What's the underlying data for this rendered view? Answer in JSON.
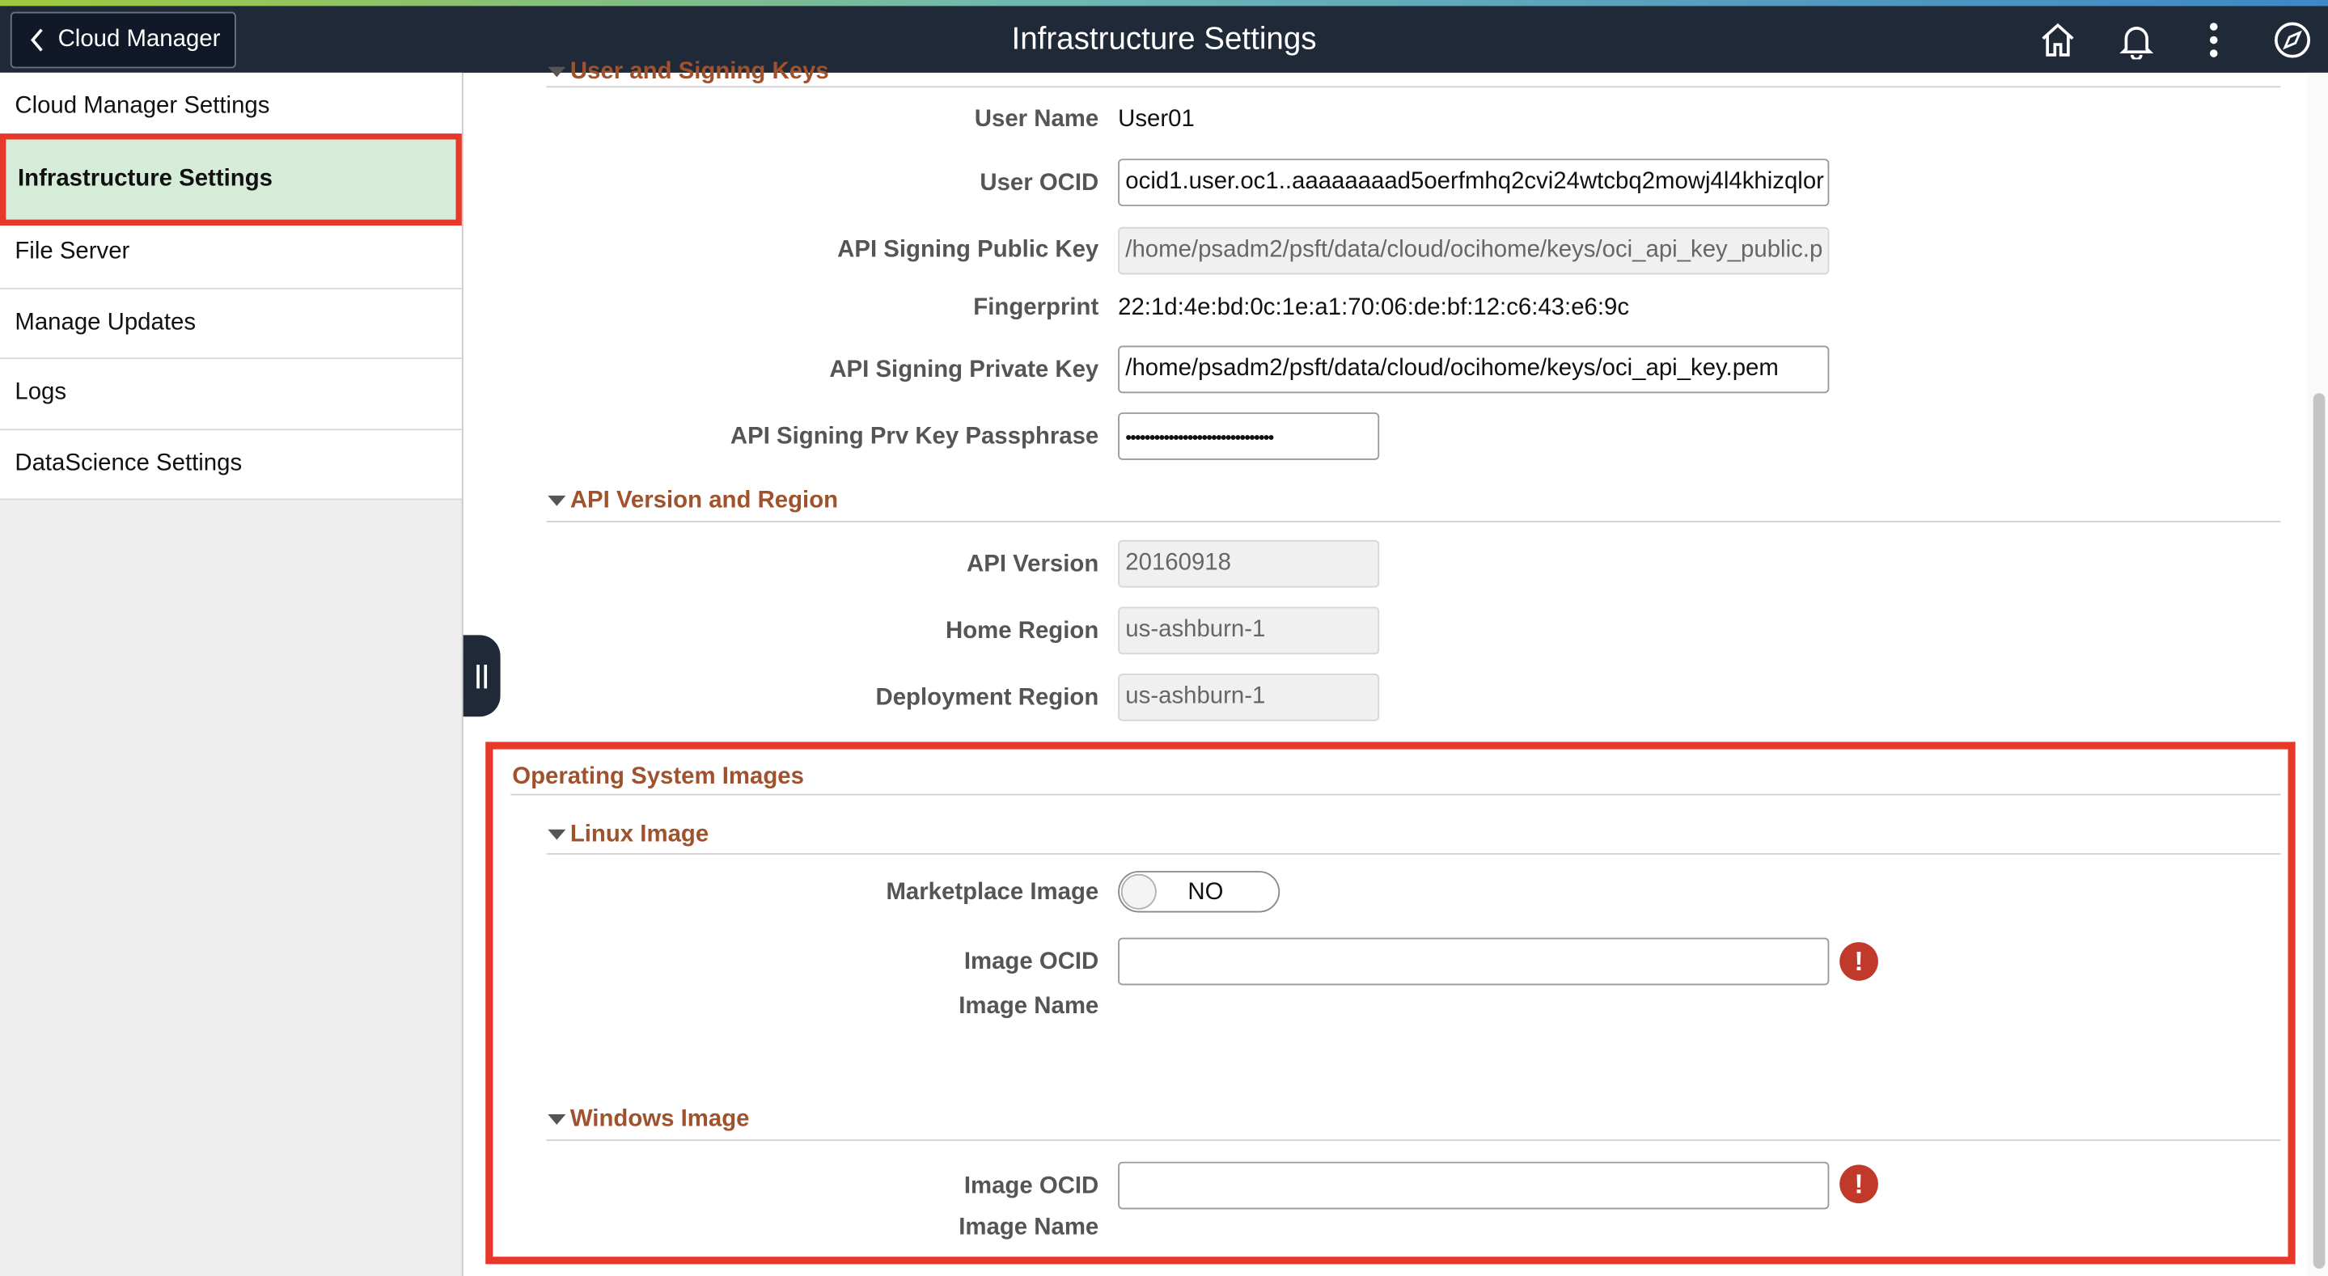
{
  "header": {
    "back_label": "Cloud Manager",
    "title": "Infrastructure Settings",
    "icons": [
      "home-icon",
      "bell-icon",
      "kebab-menu-icon",
      "navigator-compass-icon"
    ]
  },
  "sidebar": {
    "items": [
      {
        "label": "Cloud Manager Settings"
      },
      {
        "label": "Infrastructure Settings",
        "active": true
      },
      {
        "label": "File Server"
      },
      {
        "label": "Manage Updates"
      },
      {
        "label": "Logs"
      },
      {
        "label": "DataScience Settings"
      }
    ]
  },
  "user_keys": {
    "section_title": "User and Signing Keys",
    "user_name_label": "User Name",
    "user_name_value": "User01",
    "user_ocid_label": "User OCID",
    "user_ocid_value": "ocid1.user.oc1..aaaaaaaad5oerfmhq2cvi24wtcbq2mowj4l4khizqlor",
    "public_key_label": "API Signing Public Key",
    "public_key_value": "/home/psadm2/psft/data/cloud/ocihome/keys/oci_api_key_public.p",
    "fingerprint_label": "Fingerprint",
    "fingerprint_value": "22:1d:4e:bd:0c:1e:a1:70:06:de:bf:12:c6:43:e6:9c",
    "private_key_label": "API Signing Private Key",
    "private_key_value": "/home/psadm2/psft/data/cloud/ocihome/keys/oci_api_key.pem",
    "passphrase_label": "API Signing Prv Key Passphrase",
    "passphrase_value": "•••••••••••••••••••••••••••••••"
  },
  "api_region": {
    "section_title": "API Version and Region",
    "api_version_label": "API Version",
    "api_version_value": "20160918",
    "home_region_label": "Home Region",
    "home_region_value": "us-ashburn-1",
    "deployment_region_label": "Deployment Region",
    "deployment_region_value": "us-ashburn-1"
  },
  "os_images": {
    "title": "Operating System Images",
    "linux": {
      "title": "Linux Image",
      "marketplace_label": "Marketplace Image",
      "marketplace_value": "NO",
      "image_ocid_label": "Image OCID",
      "image_ocid_value": "",
      "image_name_label": "Image Name"
    },
    "windows": {
      "title": "Windows Image",
      "image_ocid_label": "Image OCID",
      "image_ocid_value": "",
      "image_name_label": "Image Name"
    },
    "error_glyph": "!"
  },
  "colors": {
    "header_bg": "#1f2937",
    "section_title": "#a0522d",
    "highlight_border": "#e8382a",
    "active_nav_bg": "#d5ecd8",
    "error_icon": "#c0392b"
  }
}
